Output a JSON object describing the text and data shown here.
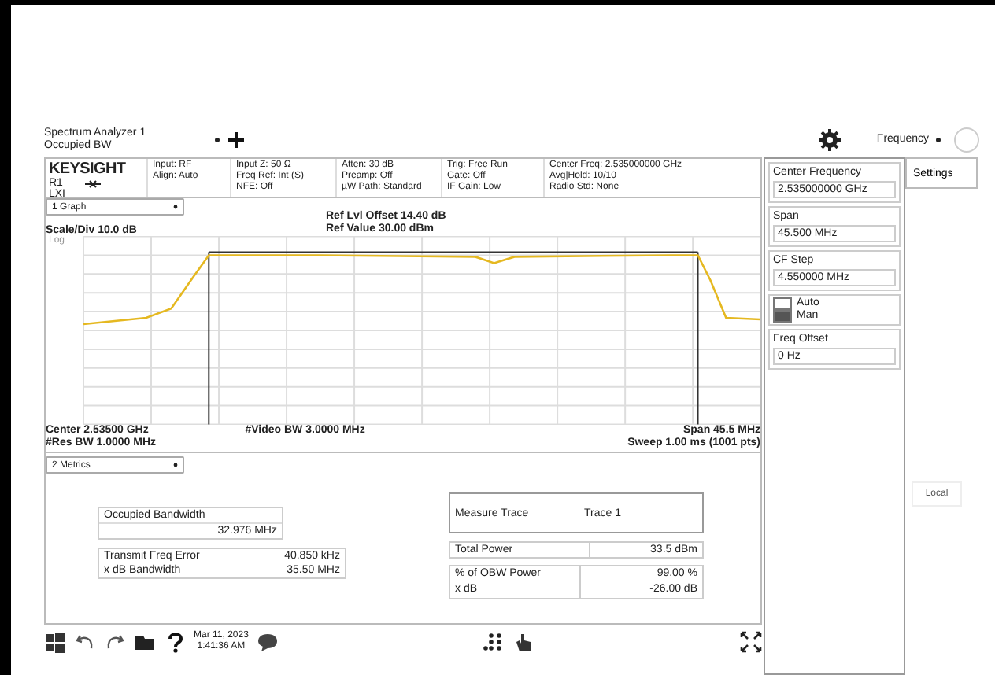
{
  "tab": {
    "title": "Spectrum Analyzer 1",
    "subtitle": "Occupied BW"
  },
  "mode": {
    "label": "Frequency"
  },
  "header": {
    "brand": "KEYSIGHT",
    "r1": "R1",
    "lxi": "LXI",
    "columns": [
      [
        "Input: RF",
        "Align: Auto"
      ],
      [
        "Input Z: 50 Ω",
        "Freq Ref: Int (S)",
        "NFE: Off"
      ],
      [
        "Atten: 30 dB",
        "Preamp: Off",
        "µW Path: Standard"
      ],
      [
        "Trig: Free Run",
        "Gate: Off",
        "IF Gain: Low"
      ],
      [
        "Center Freq: 2.535000000 GHz",
        "Avg|Hold: 10/10",
        "Radio Std: None"
      ]
    ]
  },
  "graph": {
    "selector": "1 Graph",
    "scale": "Scale/Div 10.0 dB",
    "ref_offset": "Ref Lvl Offset 14.40 dB",
    "ref_value": "Ref Value 30.00 dBm",
    "log": "Log",
    "center": "Center 2.53500 GHz",
    "res_bw": "#Res BW 1.0000 MHz",
    "video_bw": "#Video BW 3.0000 MHz",
    "span": "Span 45.5 MHz",
    "sweep": "Sweep 1.00 ms (1001 pts)"
  },
  "metrics": {
    "selector": "2 Metrics",
    "occupied": {
      "label": "Occupied Bandwidth",
      "value": "32.976 MHz"
    },
    "left_rows": [
      {
        "label": "Transmit Freq Error",
        "value": "40.850 kHz"
      },
      {
        "label": "x dB Bandwidth",
        "value": "35.50 MHz"
      }
    ],
    "measure_trace": {
      "label": "Measure Trace",
      "value": "Trace 1"
    },
    "total_power": {
      "label": "Total Power",
      "value": "33.5 dBm"
    },
    "right_rows": [
      {
        "label": "% of OBW Power",
        "value": "99.00 %"
      },
      {
        "label": "x dB",
        "value": "-26.00 dB"
      }
    ]
  },
  "panel": {
    "items": [
      {
        "kind": "field",
        "label": "Center Frequency",
        "value": "2.535000000 GHz"
      },
      {
        "kind": "field",
        "label": "Span",
        "value": "45.500 MHz"
      },
      {
        "kind": "field",
        "label": "CF Step",
        "value": "4.550000 MHz"
      },
      {
        "kind": "radio",
        "options": [
          {
            "label": "Auto",
            "selected": false
          },
          {
            "label": "Man",
            "selected": true
          }
        ]
      },
      {
        "kind": "field",
        "label": "Freq Offset",
        "value": "0 Hz"
      }
    ]
  },
  "side_tab": {
    "label": "Settings"
  },
  "local_button": {
    "label": "Local"
  },
  "taskbar": {
    "date": "Mar 11, 2023",
    "time": "1:41:36 AM"
  }
}
